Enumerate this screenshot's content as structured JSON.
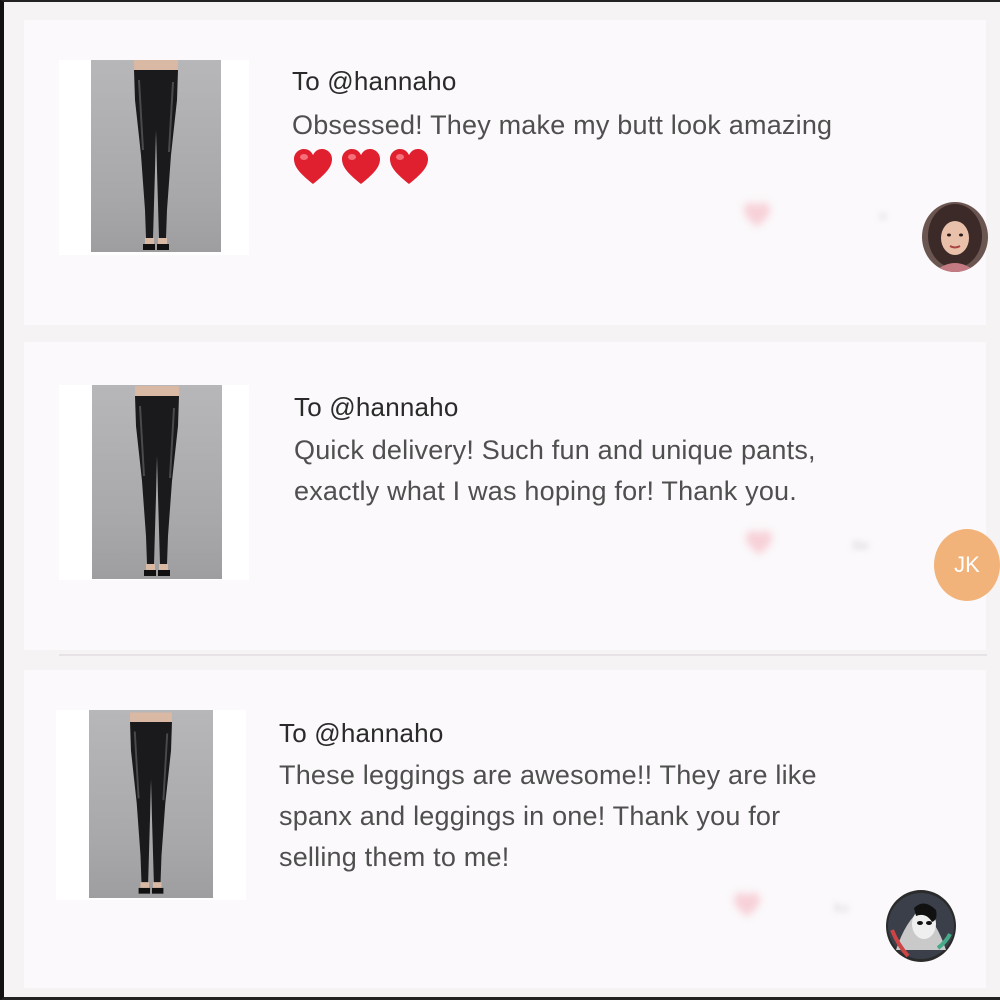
{
  "reviews": [
    {
      "to": "To @hannaho",
      "lines": [
        "Obsessed! They make my butt look amazing"
      ],
      "hearts": 3,
      "meta_blur": [
        "o",
        ""
      ],
      "avatar": {
        "type": "photo",
        "icon": "user-avatar-photo"
      }
    },
    {
      "to": "To @hannaho",
      "lines": [
        "Quick delivery! Such fun and unique pants,",
        "exactly what I was hoping for! Thank you."
      ],
      "hearts": 0,
      "meta_blur": [
        "ille",
        ""
      ],
      "avatar": {
        "type": "initials",
        "initials": "JK"
      }
    },
    {
      "to": "To @hannaho",
      "lines": [
        "These leggings are awesome!! They are like",
        "spanx and leggings in one! Thank you for",
        "selling them to me!"
      ],
      "hearts": 0,
      "meta_blur": [
        "ku",
        ""
      ],
      "avatar": {
        "type": "photo",
        "icon": "user-avatar-illustration"
      }
    }
  ],
  "colors": {
    "heart": "#e0202e",
    "initials_bg": "#f2b37a",
    "text_primary": "#2a2a2a",
    "text_secondary": "#4f4f4f"
  }
}
